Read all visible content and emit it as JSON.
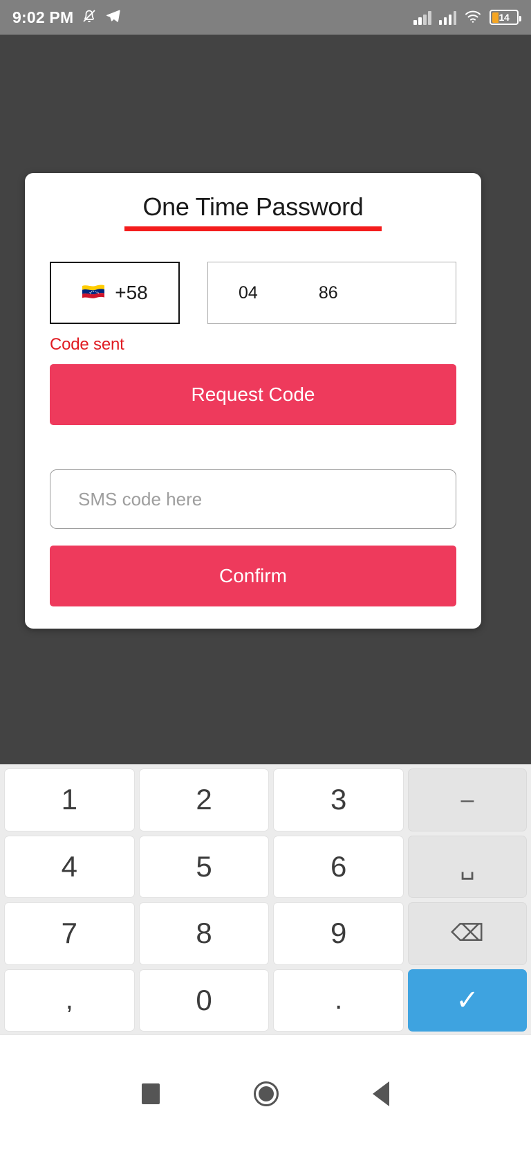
{
  "status_bar": {
    "clock": "9:02 PM",
    "mute_icon": "bell-muted-icon",
    "telegram_icon": "telegram-send-icon",
    "signal_1_icon": "signal-bars-icon",
    "signal_2_icon": "signal-bars-icon",
    "wifi_icon": "wifi-icon",
    "battery_level": "14",
    "battery_icon": "battery-icon",
    "background_color": "#808080"
  },
  "dialog": {
    "title": "One Time Password",
    "underline_color": "#F41C1C",
    "country": {
      "flag_icon": "flag-venezuela-icon",
      "flag_glyph": "🇻🇪",
      "dial_code": "+58"
    },
    "phone": {
      "prefix": "04",
      "suffix": "86"
    },
    "status_message": "Code sent",
    "status_color": "#E01B22",
    "request_button": "Request Code",
    "sms_input_placeholder": "SMS code here",
    "sms_input_value": "",
    "confirm_button": "Confirm",
    "accent_color": "#EE3A5C"
  },
  "keyboard": {
    "rows": [
      [
        {
          "label": "1",
          "name": "key-1",
          "type": "digit"
        },
        {
          "label": "2",
          "name": "key-2",
          "type": "digit"
        },
        {
          "label": "3",
          "name": "key-3",
          "type": "digit"
        },
        {
          "label": "–",
          "name": "key-dash",
          "type": "fn"
        }
      ],
      [
        {
          "label": "4",
          "name": "key-4",
          "type": "digit"
        },
        {
          "label": "5",
          "name": "key-5",
          "type": "digit"
        },
        {
          "label": "6",
          "name": "key-6",
          "type": "digit"
        },
        {
          "label": "␣",
          "name": "key-space",
          "type": "fn"
        }
      ],
      [
        {
          "label": "7",
          "name": "key-7",
          "type": "digit"
        },
        {
          "label": "8",
          "name": "key-8",
          "type": "digit"
        },
        {
          "label": "9",
          "name": "key-9",
          "type": "digit"
        },
        {
          "label": "⌫",
          "name": "key-backspace",
          "type": "fn"
        }
      ],
      [
        {
          "label": ",",
          "name": "key-comma",
          "type": "punct"
        },
        {
          "label": "0",
          "name": "key-0",
          "type": "digit"
        },
        {
          "label": ".",
          "name": "key-period",
          "type": "punct"
        },
        {
          "label": "✓",
          "name": "key-enter",
          "type": "enter"
        }
      ]
    ],
    "enter_color": "#3EA3E0",
    "background_color": "#ECECEC"
  },
  "nav_bar": {
    "recents_icon": "square-recents-icon",
    "home_icon": "circle-home-icon",
    "back_icon": "triangle-back-icon"
  }
}
